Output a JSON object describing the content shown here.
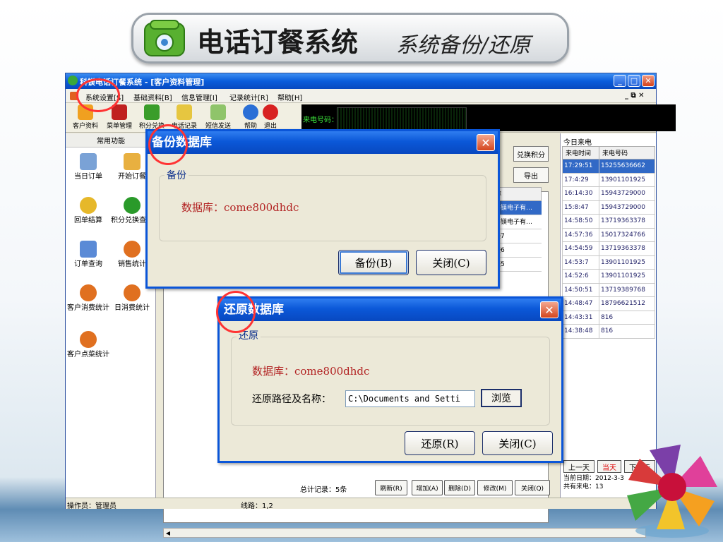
{
  "slide": {
    "title": "电话订餐系统",
    "subtitle": "系统备份/还原"
  },
  "app": {
    "title": "科镁电话订餐系统 - [客户资料管理]",
    "win_min": "_",
    "win_max": "□",
    "win_close": "✕",
    "menus": [
      "系统设置[S]",
      "基础资料[B]",
      "信息管理[I]",
      "记录统计[R]",
      "帮助[H]"
    ],
    "menu_right": "_ ⧉ ✕",
    "tools": [
      {
        "label": "客户资料",
        "icon": "users-icon",
        "color": "#f0a020"
      },
      {
        "label": "菜单管理",
        "icon": "book-icon",
        "color": "#c02020"
      },
      {
        "label": "积分兑换",
        "icon": "plant-icon",
        "color": "#3a9d2a"
      },
      {
        "label": "电话记录",
        "icon": "phone-icon",
        "color": "#e6c640"
      },
      {
        "label": "短信发送",
        "icon": "mobile-icon",
        "color": "#8fc46a"
      },
      {
        "label": "帮助",
        "icon": "help-icon",
        "color": "#2a6fd6"
      },
      {
        "label": "退出",
        "icon": "exit-icon",
        "color": "#d82222"
      }
    ],
    "caller_label": "来电号码：",
    "left": {
      "header": "常用功能",
      "items": [
        {
          "label": "当日订单",
          "icon": "document-icon",
          "color": "#7aa2d6"
        },
        {
          "label": "开始订餐",
          "icon": "pencil-icon",
          "color": "#e8b040"
        },
        {
          "label": "回单结算",
          "icon": "coins-icon",
          "color": "#e6b82a"
        },
        {
          "label": "积分兑换查询",
          "icon": "dollar-icon",
          "color": "#2a9a2a"
        },
        {
          "label": "订单查询",
          "icon": "search-icon",
          "color": "#5a8ad6"
        },
        {
          "label": "销售统计",
          "icon": "database-icon",
          "color": "#e07020"
        },
        {
          "label": "客户消费统计",
          "icon": "database-icon",
          "color": "#e07020"
        },
        {
          "label": "日消费统计",
          "icon": "database-icon",
          "color": "#e07020"
        },
        {
          "label": "客户点菜统计",
          "icon": "database-icon",
          "color": "#e07020"
        }
      ]
    },
    "center": {
      "btn_points": "兑换积分",
      "btn_export": "导出",
      "col_name": "名称",
      "rows": [
        "佰科镁电子有…",
        "佰科镁电子有…",
        "科镁7",
        "科镁6",
        "科镁5"
      ],
      "total": "总计记录：5条",
      "buttons": [
        "刷新(R)",
        "增加(A)",
        "删除(D)",
        "修改(M)",
        "关闭(Q)"
      ]
    },
    "right": {
      "title": "今日来电",
      "col_time": "来电时间",
      "col_phone": "来电号码",
      "rows": [
        [
          "17:29:51",
          "15255636662"
        ],
        [
          "17:4:29",
          "13901101925"
        ],
        [
          "16:14:30",
          "15943729000"
        ],
        [
          "15:8:47",
          "15943729000"
        ],
        [
          "14:58:50",
          "13719363378"
        ],
        [
          "14:57:36",
          "15017324766"
        ],
        [
          "14:54:59",
          "13719363378"
        ],
        [
          "14:53:7",
          "13901101925"
        ],
        [
          "14:52:6",
          "13901101925"
        ],
        [
          "14:50:51",
          "13719389768"
        ],
        [
          "14:48:47",
          "18796621512"
        ],
        [
          "14:43:31",
          "816"
        ],
        [
          "14:38:48",
          "816"
        ]
      ],
      "btn_prev": "上一天",
      "btn_today": "当天",
      "btn_next": "下一天",
      "date": "当前日期：2012-3-3",
      "count": "共有来电：13"
    },
    "status": {
      "operator": "操作员：管理员",
      "line": "线路：1,2"
    }
  },
  "backup": {
    "title": "备份数据库",
    "group": "备份",
    "db": "数据库：come800dhdc",
    "btn_backup": "备份(B)",
    "btn_close": "关闭(C)",
    "close_glyph": "✕"
  },
  "restore": {
    "title": "还原数据库",
    "group": "还原",
    "db": "数据库：come800dhdc",
    "path_label": "还原路径及名称：",
    "path_value": "C:\\Documents and Setti",
    "btn_browse": "浏览",
    "btn_restore": "还原(R)",
    "btn_close": "关闭(C)",
    "close_glyph": "✕"
  },
  "colors": {
    "xp_blue": "#0a55d8",
    "db_red": "#b22222",
    "highlight_circle": "#ff3333"
  }
}
